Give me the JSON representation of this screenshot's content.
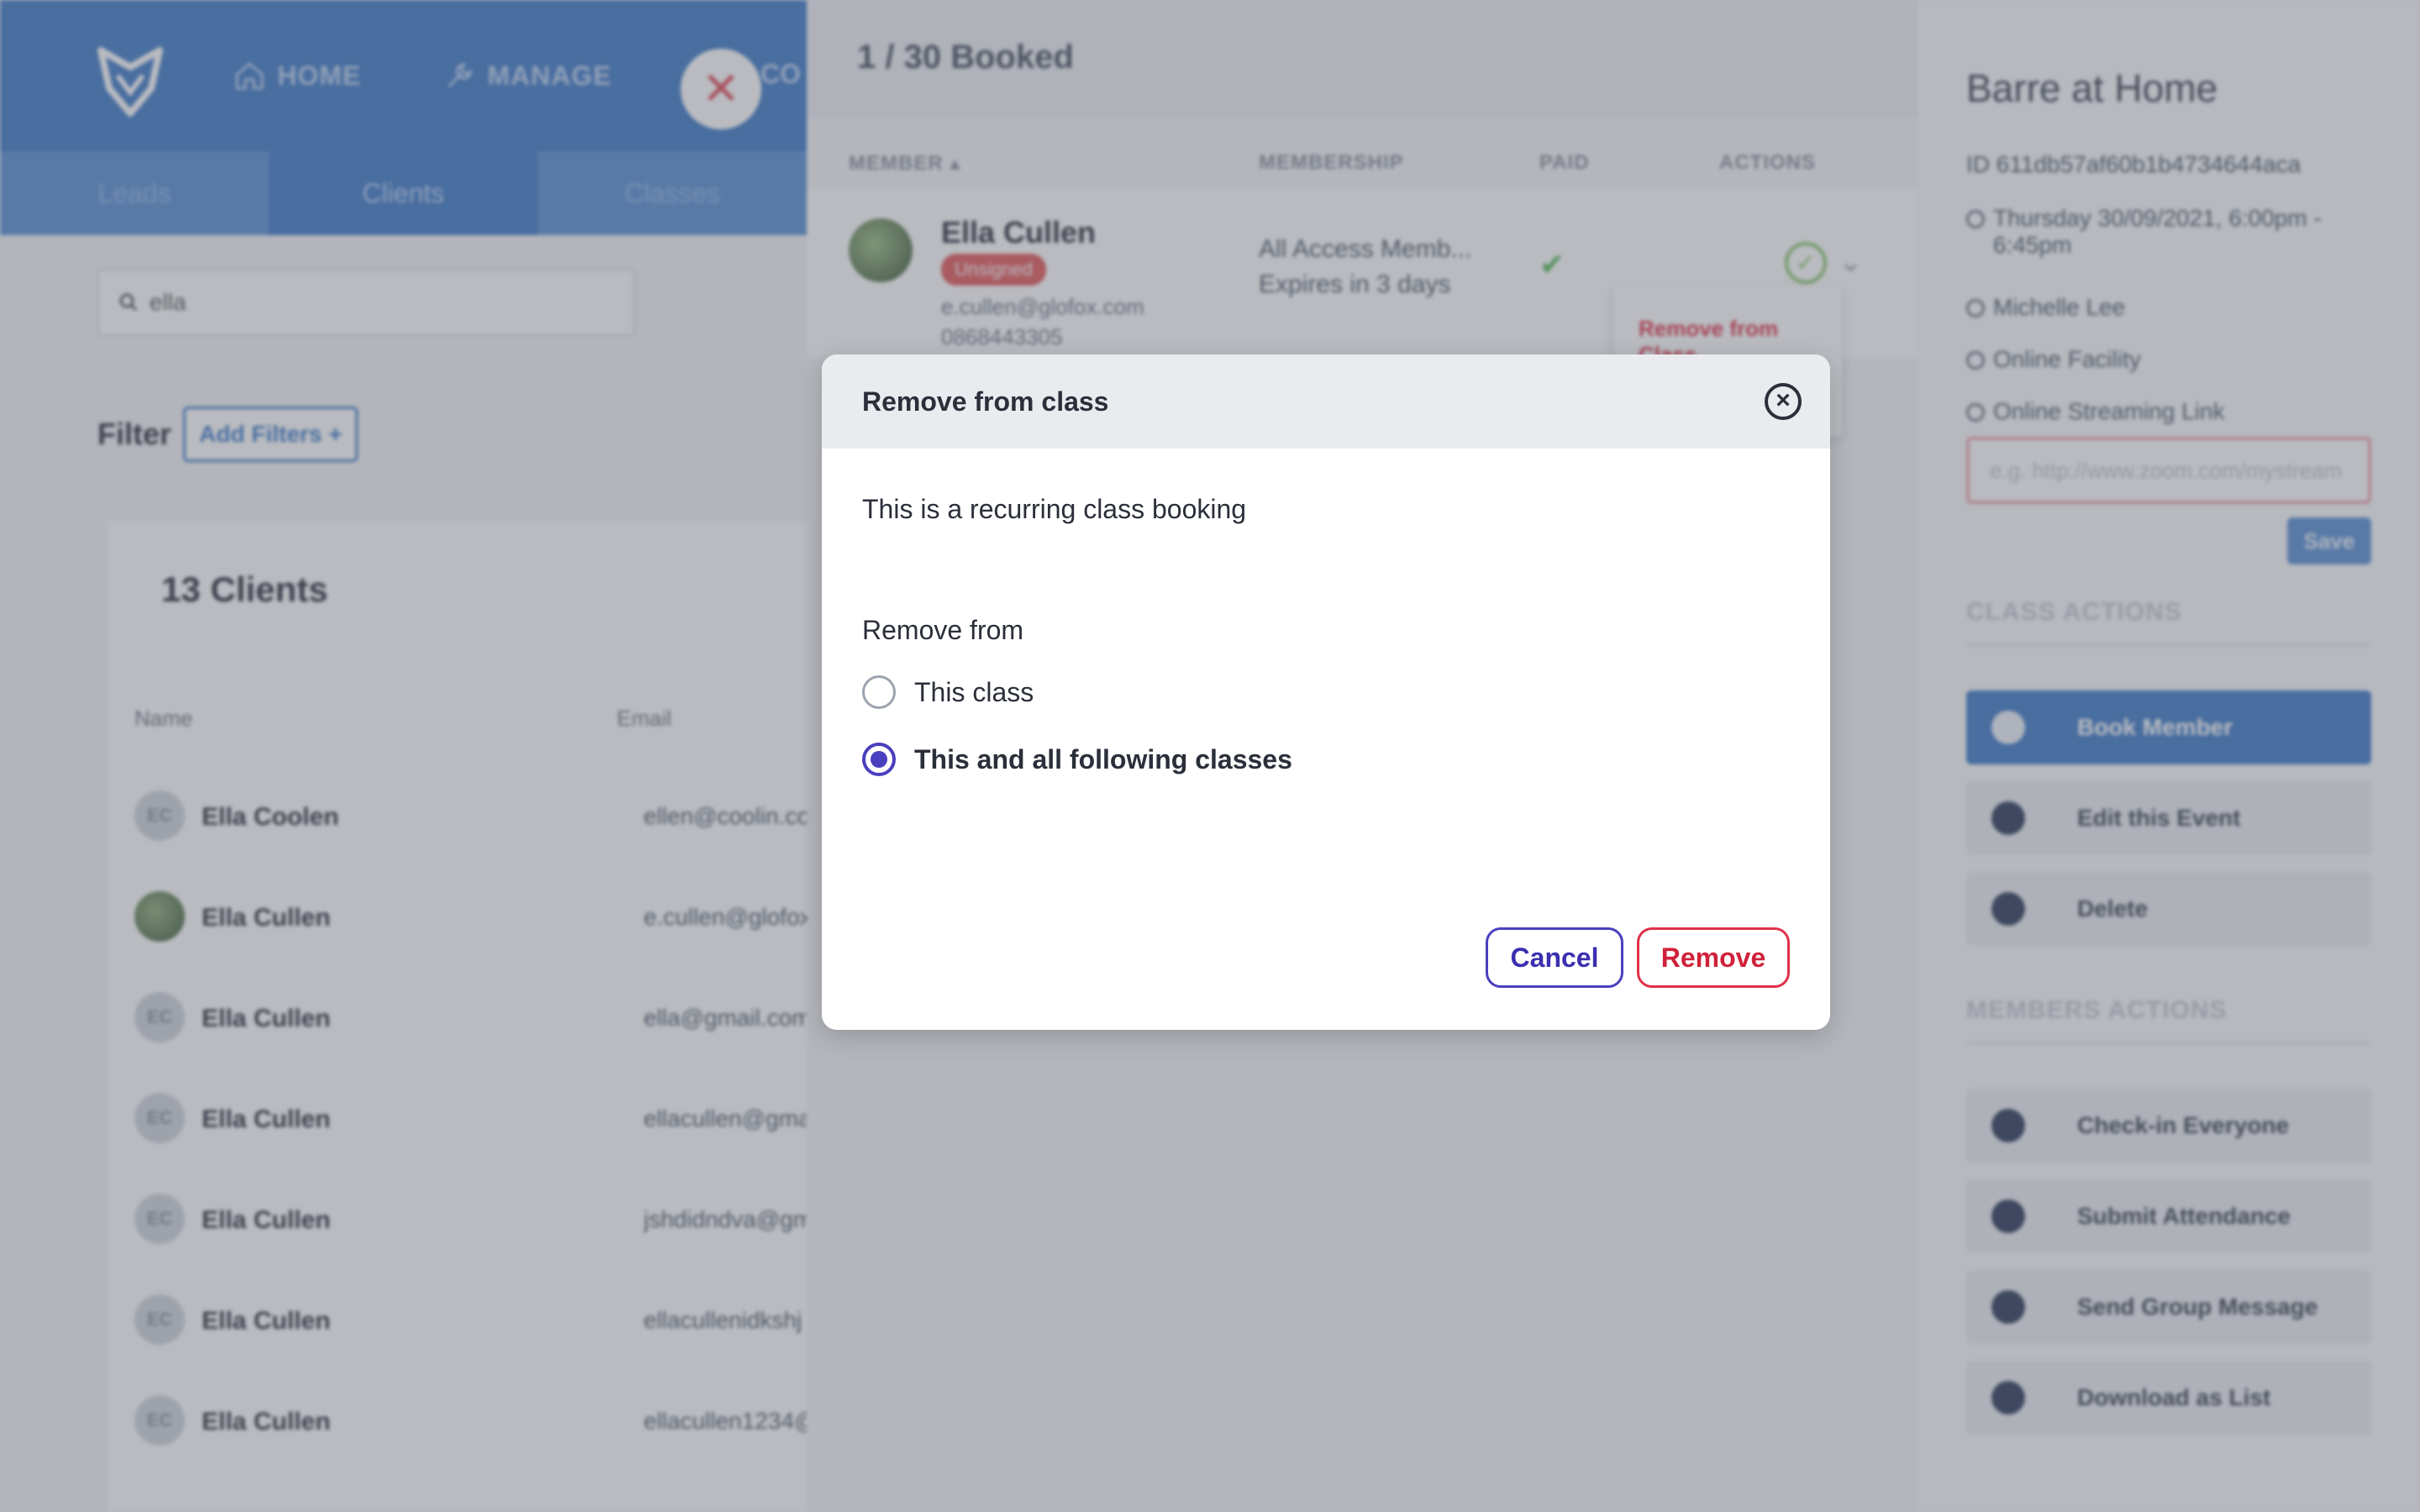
{
  "nav": {
    "home": "HOME",
    "manage": "MANAGE",
    "partial": "CO",
    "close": "✕"
  },
  "subnav": {
    "leads": "Leads",
    "clients": "Clients",
    "classes": "Classes"
  },
  "search": {
    "value": "ella"
  },
  "filter": {
    "label": "Filter",
    "add_button": "Add Filters +"
  },
  "clients": {
    "title": "13 Clients",
    "col_name": "Name",
    "col_email": "Email",
    "rows": [
      {
        "initials": "EC",
        "name": "Ella Coolen",
        "email": "ellen@coolin.co"
      },
      {
        "initials": "",
        "name": "Ella Cullen",
        "email": "e.cullen@glofox"
      },
      {
        "initials": "EC",
        "name": "Ella Cullen",
        "email": "ella@gmail.com"
      },
      {
        "initials": "EC",
        "name": "Ella Cullen",
        "email": "ellacullen@gma"
      },
      {
        "initials": "EC",
        "name": "Ella Cullen",
        "email": "jshdidndva@gm"
      },
      {
        "initials": "EC",
        "name": "Ella Cullen",
        "email": "ellacullenidkshj"
      },
      {
        "initials": "EC",
        "name": "Ella Cullen",
        "email": "ellacullen1234@"
      }
    ]
  },
  "booking": {
    "title": "1 / 30 Booked",
    "headers": {
      "member": "MEMBER ▴",
      "membership": "MEMBERSHIP",
      "paid": "PAID",
      "actions": "ACTIONS"
    },
    "member": {
      "name": "Ella Cullen",
      "badge": "Unsigned",
      "email": "e.cullen@glofox.com",
      "phone": "0868443305",
      "membership_line1": "All Access Memb...",
      "membership_line2": "Expires in 3 days"
    },
    "dropdown_item": "Remove from Class"
  },
  "event": {
    "title": "Barre at Home",
    "id": "ID 611db57af60b1b4734644aca",
    "datetime": "Thursday 30/09/2021, 6:00pm - 6:45pm",
    "trainer": "Michelle Lee",
    "facility": "Online Facility",
    "stream_label": "Online Streaming Link",
    "stream_placeholder": "e.g. http://www.zoom.com/mystream",
    "save": "Save",
    "class_actions": "CLASS ACTIONS",
    "members_actions": "MEMBERS ACTIONS",
    "buttons": {
      "book_member": "Book Member",
      "edit_event": "Edit this Event",
      "delete": "Delete",
      "check_in": "Check-in Everyone",
      "submit_attendance": "Submit Attendance",
      "send_message": "Send Group Message",
      "download_list": "Download as List"
    }
  },
  "modal": {
    "title": "Remove from class",
    "message": "This is a recurring class booking",
    "label": "Remove from",
    "options": [
      {
        "label": "This class",
        "selected": false
      },
      {
        "label": "This and all following classes",
        "selected": true
      }
    ],
    "cancel": "Cancel",
    "remove": "Remove"
  },
  "colors": {
    "primary": "#3e7ac8",
    "accent": "#4a3fbf",
    "danger": "#e0314a"
  }
}
